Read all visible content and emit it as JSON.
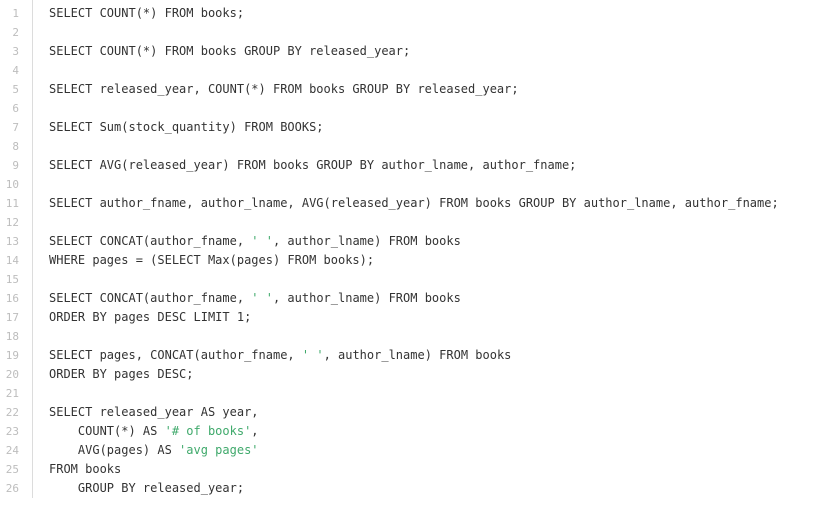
{
  "editor": {
    "lines": [
      {
        "n": "1",
        "parts": [
          {
            "t": "SELECT COUNT(*) FROM books;",
            "k": "code"
          }
        ]
      },
      {
        "n": "2",
        "parts": []
      },
      {
        "n": "3",
        "parts": [
          {
            "t": "SELECT COUNT(*) FROM books GROUP BY released_year;",
            "k": "code"
          }
        ]
      },
      {
        "n": "4",
        "parts": []
      },
      {
        "n": "5",
        "parts": [
          {
            "t": "SELECT released_year, COUNT(*) FROM books GROUP BY released_year;",
            "k": "code"
          }
        ]
      },
      {
        "n": "6",
        "parts": []
      },
      {
        "n": "7",
        "parts": [
          {
            "t": "SELECT Sum(stock_quantity) FROM BOOKS;",
            "k": "code"
          }
        ]
      },
      {
        "n": "8",
        "parts": []
      },
      {
        "n": "9",
        "parts": [
          {
            "t": "SELECT AVG(released_year) FROM books GROUP BY author_lname, author_fname;",
            "k": "code"
          }
        ]
      },
      {
        "n": "10",
        "parts": []
      },
      {
        "n": "11",
        "parts": [
          {
            "t": "SELECT author_fname, author_lname, AVG(released_year) FROM books GROUP BY author_lname, author_fname;",
            "k": "code"
          }
        ]
      },
      {
        "n": "12",
        "parts": []
      },
      {
        "n": "13",
        "parts": [
          {
            "t": "SELECT CONCAT(author_fname, ",
            "k": "code"
          },
          {
            "t": "' '",
            "k": "str"
          },
          {
            "t": ", author_lname) FROM books",
            "k": "code"
          }
        ]
      },
      {
        "n": "14",
        "parts": [
          {
            "t": "WHERE pages = (SELECT Max(pages) FROM books);",
            "k": "code"
          }
        ]
      },
      {
        "n": "15",
        "parts": []
      },
      {
        "n": "16",
        "parts": [
          {
            "t": "SELECT CONCAT(author_fname, ",
            "k": "code"
          },
          {
            "t": "' '",
            "k": "str"
          },
          {
            "t": ", author_lname) FROM books",
            "k": "code"
          }
        ]
      },
      {
        "n": "17",
        "parts": [
          {
            "t": "ORDER BY pages DESC LIMIT 1;",
            "k": "code"
          }
        ]
      },
      {
        "n": "18",
        "parts": []
      },
      {
        "n": "19",
        "parts": [
          {
            "t": "SELECT pages, CONCAT(author_fname, ",
            "k": "code"
          },
          {
            "t": "' '",
            "k": "str"
          },
          {
            "t": ", author_lname) FROM books",
            "k": "code"
          }
        ]
      },
      {
        "n": "20",
        "parts": [
          {
            "t": "ORDER BY pages DESC;",
            "k": "code"
          }
        ]
      },
      {
        "n": "21",
        "parts": []
      },
      {
        "n": "22",
        "parts": [
          {
            "t": "SELECT released_year AS year,",
            "k": "code"
          }
        ]
      },
      {
        "n": "23",
        "parts": [
          {
            "t": "    COUNT(*) AS ",
            "k": "code"
          },
          {
            "t": "'# of books'",
            "k": "str"
          },
          {
            "t": ",",
            "k": "code"
          }
        ]
      },
      {
        "n": "24",
        "parts": [
          {
            "t": "    AVG(pages) AS ",
            "k": "code"
          },
          {
            "t": "'avg pages'",
            "k": "str"
          }
        ]
      },
      {
        "n": "25",
        "parts": [
          {
            "t": "FROM books",
            "k": "code"
          }
        ]
      },
      {
        "n": "26",
        "parts": [
          {
            "t": "    GROUP BY released_year;",
            "k": "code"
          }
        ]
      }
    ]
  },
  "colors": {
    "text": "#333333",
    "string": "#3fa96b",
    "line_number": "#bdbdbd",
    "gutter_border": "#dcdcdc"
  }
}
